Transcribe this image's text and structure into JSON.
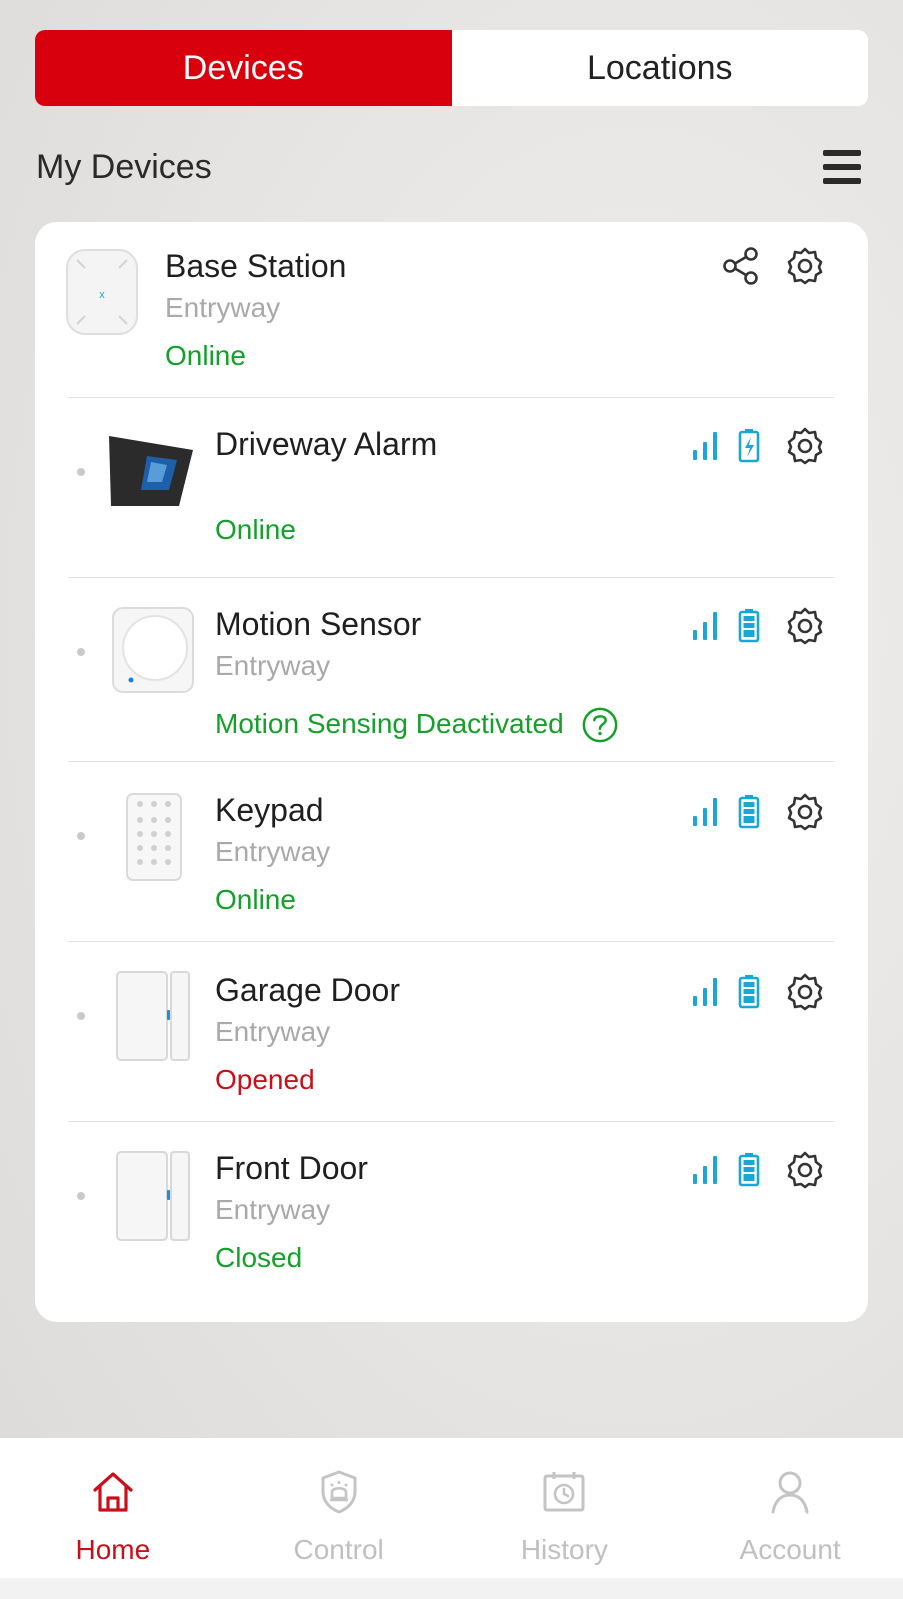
{
  "tabs": [
    {
      "label": "Devices",
      "active": true
    },
    {
      "label": "Locations",
      "active": false
    }
  ],
  "header": {
    "title": "My Devices"
  },
  "devices": [
    {
      "name": "Base Station",
      "location": "Entryway",
      "status": "Online",
      "status_color": "#14a02a"
    },
    {
      "name": "Driveway Alarm",
      "location": "",
      "status": "Online",
      "status_color": "#14a02a"
    },
    {
      "name": "Motion Sensor",
      "location": "Entryway",
      "status": "Motion Sensing Deactivated",
      "status_color": "#14a02a"
    },
    {
      "name": "Keypad",
      "location": "Entryway",
      "status": "Online",
      "status_color": "#14a02a"
    },
    {
      "name": "Garage Door",
      "location": "Entryway",
      "status": "Opened",
      "status_color": "#c8101b"
    },
    {
      "name": "Front Door",
      "location": "Entryway",
      "status": "Closed",
      "status_color": "#14a02a"
    }
  ],
  "nav": [
    {
      "label": "Home",
      "icon": "home-icon",
      "active": true
    },
    {
      "label": "Control",
      "icon": "shield-alarm-icon",
      "active": false
    },
    {
      "label": "History",
      "icon": "history-icon",
      "active": false
    },
    {
      "label": "Account",
      "icon": "account-icon",
      "active": false
    }
  ],
  "colors": {
    "brand_red": "#d9000d",
    "online_green": "#14a02a",
    "alert_red": "#c8101b",
    "status_icon_blue": "#1aa7d8"
  }
}
